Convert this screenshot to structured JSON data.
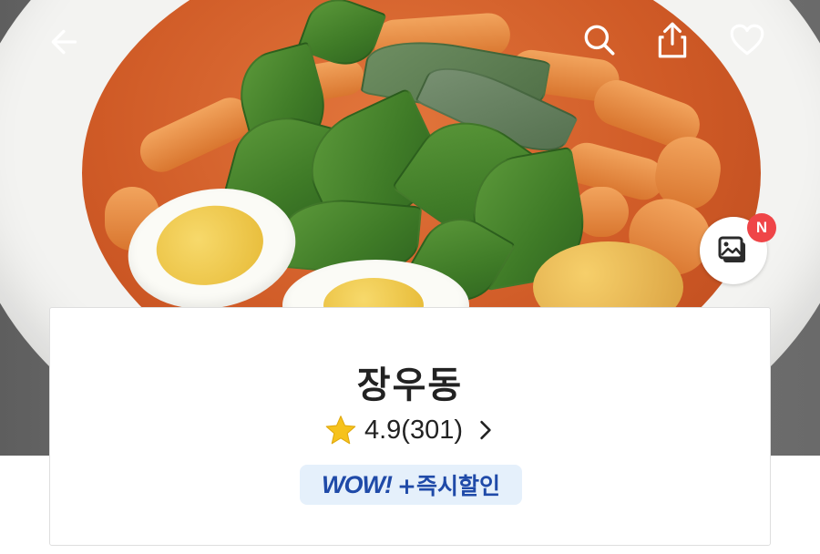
{
  "colors": {
    "hero_bg": "#6c6c6c",
    "white": "#ffffff",
    "accent_red": "#ef4548",
    "star": "#f6c21c",
    "text_dark": "#222222",
    "promo_bg": "#e5f0fb",
    "promo_text": "#1f4aa8"
  },
  "top_bar": {
    "back_icon": "arrow-left",
    "search_icon": "magnifier",
    "share_icon": "share-box-arrow-up",
    "favorite_icon": "heart-outline"
  },
  "hero": {
    "image_description_icon": "food-photo",
    "photo_review_icon": "photo-stack",
    "new_badge": "N"
  },
  "store": {
    "name": "장우동",
    "rating_icon": "star",
    "rating": "4.9(301)",
    "chevron_icon": "chevron-right",
    "promo": {
      "wow": "WOW!",
      "label": "+즉시할인"
    }
  }
}
